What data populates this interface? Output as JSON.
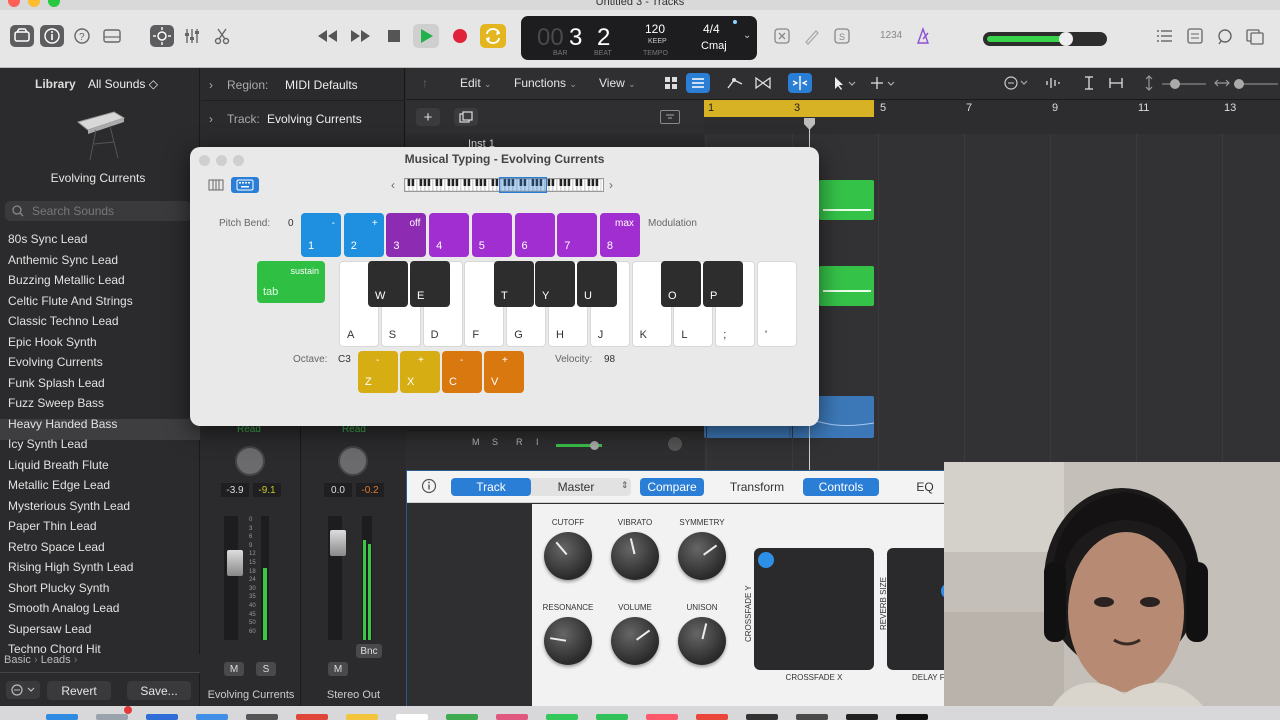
{
  "window": {
    "title": "Untitled 3 - Tracks"
  },
  "lcd": {
    "bar": "3",
    "beat": "2",
    "bar_label": "BAR",
    "beat_label": "BEAT",
    "tempo": "120",
    "tempo_mode": "KEEP",
    "tempo_label": "TEMPO",
    "signature": "4/4",
    "key": "Cmaj"
  },
  "toolbar": {
    "counter_label": "1234"
  },
  "library": {
    "label": "Library",
    "filter": "All Sounds ◇",
    "selected_patch": "Evolving Currents",
    "search_placeholder": "Search Sounds",
    "items": [
      "80s Sync Lead",
      "Anthemic Sync Lead",
      "Buzzing Metallic Lead",
      "Celtic Flute And Strings",
      "Classic Techno Lead",
      "Epic Hook Synth",
      "Evolving Currents",
      "Funk Splash Lead",
      "Fuzz Sweep Bass",
      "Heavy Handed Bass",
      "Icy Synth Lead",
      "Liquid Breath Flute",
      "Metallic Edge Lead",
      "Mysterious Synth Lead",
      "Paper Thin Lead",
      "Retro Space Lead",
      "Rising High Synth Lead",
      "Short Plucky Synth",
      "Smooth Analog Lead",
      "Supersaw Lead",
      "Techno Chord Hit"
    ],
    "breadcrumb": [
      "Basic",
      "Leads"
    ],
    "revert": "Revert",
    "save": "Save..."
  },
  "inspector": {
    "region_label": "Region:",
    "region_value": "MIDI Defaults",
    "track_label": "Track:",
    "track_value": "Evolving Currents",
    "strip1": {
      "automation": "Read",
      "pan_value": "-3.9",
      "peak": "-9.1",
      "name": "Evolving Currents",
      "m": "M",
      "s": "S"
    },
    "strip2": {
      "automation": "Read",
      "pan_value": "0.0",
      "peak": "-0.2",
      "name": "Stereo Out",
      "m": "M",
      "bnc": "Bnc"
    },
    "scale": [
      "0",
      "3",
      "6",
      "9",
      "12",
      "15",
      "18",
      "24",
      "30",
      "35",
      "40",
      "45",
      "50",
      "60"
    ]
  },
  "tracks": {
    "menus": [
      "Edit",
      "Functions",
      "View"
    ],
    "ruler": [
      "1",
      "3",
      "5",
      "7",
      "9",
      "11",
      "13"
    ],
    "track_name": "Inst 1",
    "track_buttons": [
      "M",
      "S",
      "R",
      "I"
    ]
  },
  "musical_typing": {
    "title": "Musical Typing - Evolving Currents",
    "pitch_bend_label": "Pitch Bend:",
    "pitch_bend_value": "0",
    "modulation_label": "Modulation",
    "top_keys": [
      {
        "key": "1",
        "top": "-",
        "color": "#1f8fdf"
      },
      {
        "key": "2",
        "top": "+",
        "color": "#1f8fdf"
      },
      {
        "key": "3",
        "top": "off",
        "color": "#8e2bb3"
      },
      {
        "key": "4",
        "top": "",
        "color": "#a12ed0"
      },
      {
        "key": "5",
        "top": "",
        "color": "#a12ed0"
      },
      {
        "key": "6",
        "top": "",
        "color": "#a12ed0"
      },
      {
        "key": "7",
        "top": "",
        "color": "#a12ed0"
      },
      {
        "key": "8",
        "top": "max",
        "color": "#a12ed0"
      }
    ],
    "sustain_label": "sustain",
    "tab_label": "tab",
    "black_keys": [
      "W",
      "E",
      "T",
      "Y",
      "U",
      "O",
      "P"
    ],
    "white_keys": [
      "A",
      "S",
      "D",
      "F",
      "G",
      "H",
      "J",
      "K",
      "L",
      ";",
      "'"
    ],
    "octave_label": "Octave:",
    "octave_value": "C3",
    "octave_keys": [
      {
        "key": "Z",
        "top": "-"
      },
      {
        "key": "X",
        "top": "+"
      }
    ],
    "velocity_keys": [
      {
        "key": "C",
        "top": "-"
      },
      {
        "key": "V",
        "top": "+"
      }
    ],
    "velocity_label": "Velocity:",
    "velocity_value": "98"
  },
  "plugin": {
    "tabs": {
      "track": "Track",
      "master": "Master",
      "compare": "Compare",
      "transform": "Transform",
      "controls": "Controls",
      "eq": "EQ"
    },
    "knobs": [
      {
        "label": "CUTOFF",
        "value": 0.35
      },
      {
        "label": "VIBRATO",
        "value": 0.45
      },
      {
        "label": "SYMMETRY",
        "value": 0.7
      },
      {
        "label": "RESONANCE",
        "value": 0.2
      },
      {
        "label": "VOLUME",
        "value": 0.7
      },
      {
        "label": "UNISON",
        "value": 0.55
      }
    ],
    "pad1": {
      "x_label": "CROSSFADE X",
      "y_label": "CROSSFADE Y"
    },
    "pad2": {
      "x_label": "DELAY F",
      "y_label": "REVERB SIZE"
    }
  },
  "colors": {
    "accent": "#2a7ed6",
    "green": "#2ec84a",
    "yellow": "#d7ad14",
    "orange": "#d8780f",
    "region_blue": "#3c78b8"
  }
}
